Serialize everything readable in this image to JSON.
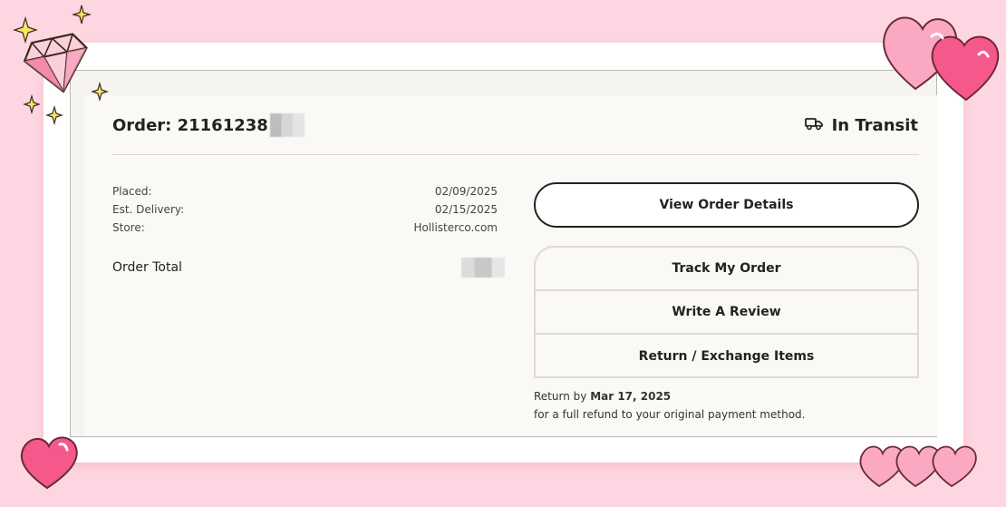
{
  "order": {
    "label": "Order: 21161238",
    "status": "In Transit"
  },
  "details": [
    {
      "label": "Placed:",
      "value": "02/09/2025"
    },
    {
      "label": "Est. Delivery:",
      "value": "02/15/2025"
    },
    {
      "label": "Store:",
      "value": "Hollisterco.com"
    }
  ],
  "total": {
    "label": "Order Total"
  },
  "actions": {
    "view_details": "View Order Details",
    "track": "Track My Order",
    "review": "Write A Review",
    "return_exchange": "Return / Exchange Items"
  },
  "return_policy": {
    "prefix": "Return by",
    "date": "Mar 17, 2025",
    "suffix": "for a full refund to your original payment method."
  },
  "icons": {
    "status": "truck-icon",
    "decorations": [
      "diamond-sticker",
      "sparkle-sticker",
      "heart-sticker"
    ]
  },
  "colors": {
    "background": "#fdd6e1",
    "card": "#faf9f6",
    "text": "#222222",
    "heart": "#f56b99"
  }
}
